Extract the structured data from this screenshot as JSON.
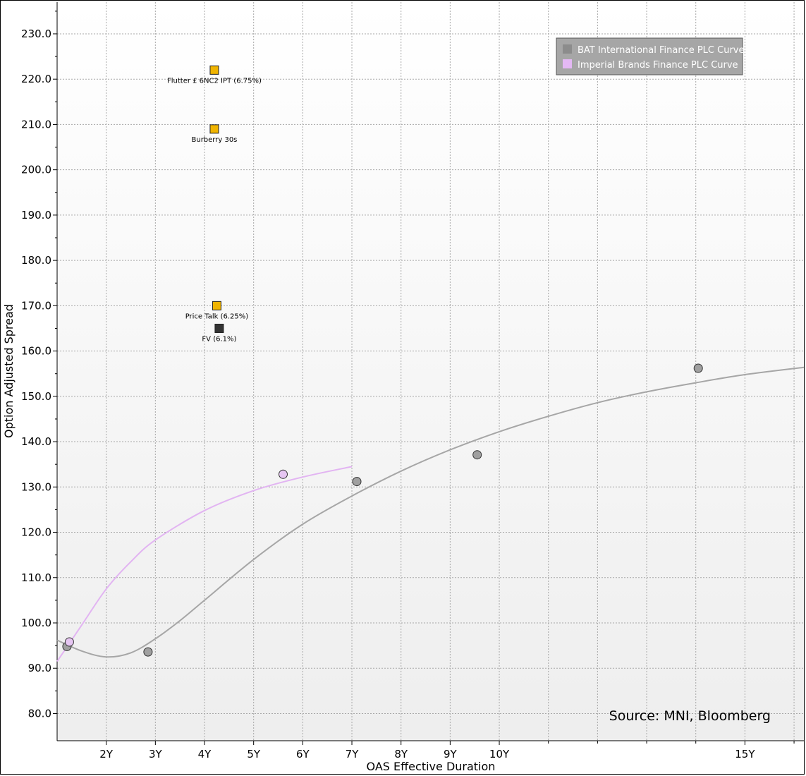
{
  "chart_data": {
    "type": "scatter",
    "xlabel": "OAS Effective Duration",
    "ylabel": "Option Adjusted Spread",
    "xlim": [
      1,
      16.2
    ],
    "ylim": [
      74,
      237
    ],
    "x_ticks": [
      {
        "value": 2,
        "label": "2Y"
      },
      {
        "value": 3,
        "label": "3Y"
      },
      {
        "value": 4,
        "label": "4Y"
      },
      {
        "value": 5,
        "label": "5Y"
      },
      {
        "value": 6,
        "label": "6Y"
      },
      {
        "value": 7,
        "label": "7Y"
      },
      {
        "value": 8,
        "label": "8Y"
      },
      {
        "value": 9,
        "label": "9Y"
      },
      {
        "value": 10,
        "label": "10Y"
      },
      {
        "value": 15,
        "label": "15Y"
      }
    ],
    "x_minor_ticks": [
      11,
      12,
      13,
      14,
      16
    ],
    "y_ticks": [
      {
        "value": 80,
        "label": "80.0"
      },
      {
        "value": 90,
        "label": "90.0"
      },
      {
        "value": 100,
        "label": "100.0"
      },
      {
        "value": 110,
        "label": "110.0"
      },
      {
        "value": 120,
        "label": "120.0"
      },
      {
        "value": 130,
        "label": "130.0"
      },
      {
        "value": 140,
        "label": "140.0"
      },
      {
        "value": 150,
        "label": "150.0"
      },
      {
        "value": 160,
        "label": "160.0"
      },
      {
        "value": 170,
        "label": "170.0"
      },
      {
        "value": 180,
        "label": "180.0"
      },
      {
        "value": 190,
        "label": "190.0"
      },
      {
        "value": 200,
        "label": "200.0"
      },
      {
        "value": 210,
        "label": "210.0"
      },
      {
        "value": 220,
        "label": "220.0"
      },
      {
        "value": 230,
        "label": "230.0"
      }
    ],
    "grid": true,
    "legend_position": "top-right",
    "source": "Source: MNI, Bloomberg",
    "series": [
      {
        "name": "BAT International Finance PLC Curve",
        "color": "#a6a6a6",
        "marker_fill": "#a0a0a0",
        "points": [
          {
            "x": 1.2,
            "y": 94.8
          },
          {
            "x": 2.85,
            "y": 93.6
          },
          {
            "x": 7.1,
            "y": 131.2
          },
          {
            "x": 9.55,
            "y": 137.1
          },
          {
            "x": 14.05,
            "y": 156.2
          }
        ],
        "curve": [
          {
            "x": 1.0,
            "y": 96.2
          },
          {
            "x": 1.5,
            "y": 93.8
          },
          {
            "x": 2.0,
            "y": 92.5
          },
          {
            "x": 2.5,
            "y": 93.4
          },
          {
            "x": 3.0,
            "y": 96.5
          },
          {
            "x": 3.5,
            "y": 100.5
          },
          {
            "x": 4.0,
            "y": 105.0
          },
          {
            "x": 5.0,
            "y": 114.0
          },
          {
            "x": 6.0,
            "y": 121.8
          },
          {
            "x": 7.0,
            "y": 128.0
          },
          {
            "x": 8.0,
            "y": 133.5
          },
          {
            "x": 9.0,
            "y": 138.2
          },
          {
            "x": 10.0,
            "y": 142.2
          },
          {
            "x": 11.0,
            "y": 145.6
          },
          {
            "x": 12.0,
            "y": 148.6
          },
          {
            "x": 13.0,
            "y": 151.0
          },
          {
            "x": 14.0,
            "y": 153.0
          },
          {
            "x": 15.0,
            "y": 154.8
          },
          {
            "x": 16.2,
            "y": 156.4
          }
        ]
      },
      {
        "name": "Imperial Brands Finance PLC Curve",
        "color": "#e2b4f2",
        "marker_fill": "#e6c6f2",
        "points": [
          {
            "x": 1.25,
            "y": 95.8
          },
          {
            "x": 5.6,
            "y": 132.8
          }
        ],
        "curve": [
          {
            "x": 1.0,
            "y": 91.5
          },
          {
            "x": 1.5,
            "y": 99.5
          },
          {
            "x": 2.0,
            "y": 107.5
          },
          {
            "x": 2.5,
            "y": 113.5
          },
          {
            "x": 3.0,
            "y": 118.3
          },
          {
            "x": 4.0,
            "y": 124.8
          },
          {
            "x": 5.0,
            "y": 129.2
          },
          {
            "x": 6.0,
            "y": 132.2
          },
          {
            "x": 7.0,
            "y": 134.5
          }
        ]
      }
    ],
    "annotations": [
      {
        "label": "Flutter £ 6NC2 IPT (6.75%)",
        "x": 4.2,
        "y": 222,
        "fill": "#f0b400"
      },
      {
        "label": "Burberry 30s",
        "x": 4.2,
        "y": 209,
        "fill": "#f0b400"
      },
      {
        "label": "Price Talk (6.25%)",
        "x": 4.25,
        "y": 170,
        "fill": "#f0b400"
      },
      {
        "label": "FV (6.1%)",
        "x": 4.3,
        "y": 165,
        "fill": "#333333"
      }
    ]
  }
}
